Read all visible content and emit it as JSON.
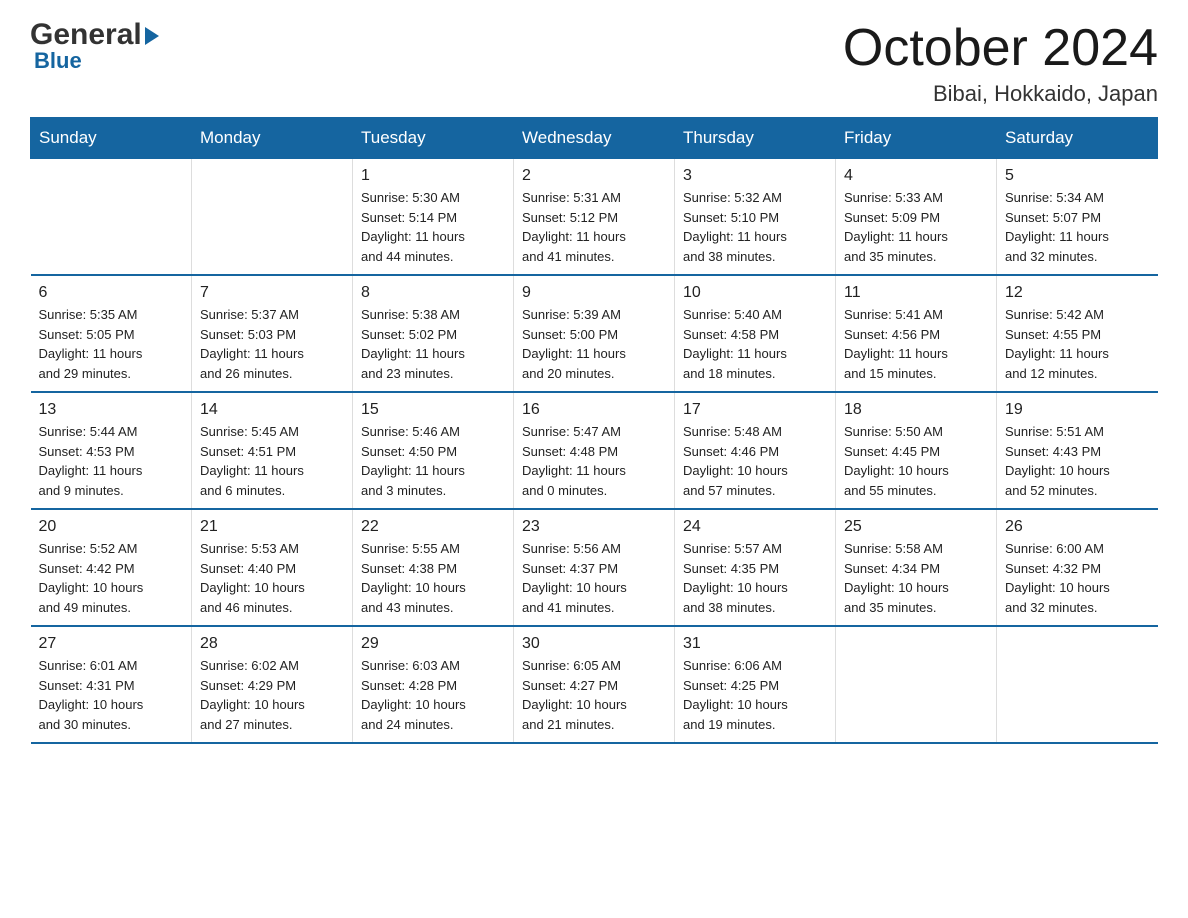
{
  "header": {
    "logo_general": "General",
    "logo_blue": "Blue",
    "title": "October 2024",
    "location": "Bibai, Hokkaido, Japan"
  },
  "calendar": {
    "days": [
      "Sunday",
      "Monday",
      "Tuesday",
      "Wednesday",
      "Thursday",
      "Friday",
      "Saturday"
    ],
    "weeks": [
      [
        {
          "number": "",
          "detail": ""
        },
        {
          "number": "",
          "detail": ""
        },
        {
          "number": "1",
          "detail": "Sunrise: 5:30 AM\nSunset: 5:14 PM\nDaylight: 11 hours\nand 44 minutes."
        },
        {
          "number": "2",
          "detail": "Sunrise: 5:31 AM\nSunset: 5:12 PM\nDaylight: 11 hours\nand 41 minutes."
        },
        {
          "number": "3",
          "detail": "Sunrise: 5:32 AM\nSunset: 5:10 PM\nDaylight: 11 hours\nand 38 minutes."
        },
        {
          "number": "4",
          "detail": "Sunrise: 5:33 AM\nSunset: 5:09 PM\nDaylight: 11 hours\nand 35 minutes."
        },
        {
          "number": "5",
          "detail": "Sunrise: 5:34 AM\nSunset: 5:07 PM\nDaylight: 11 hours\nand 32 minutes."
        }
      ],
      [
        {
          "number": "6",
          "detail": "Sunrise: 5:35 AM\nSunset: 5:05 PM\nDaylight: 11 hours\nand 29 minutes."
        },
        {
          "number": "7",
          "detail": "Sunrise: 5:37 AM\nSunset: 5:03 PM\nDaylight: 11 hours\nand 26 minutes."
        },
        {
          "number": "8",
          "detail": "Sunrise: 5:38 AM\nSunset: 5:02 PM\nDaylight: 11 hours\nand 23 minutes."
        },
        {
          "number": "9",
          "detail": "Sunrise: 5:39 AM\nSunset: 5:00 PM\nDaylight: 11 hours\nand 20 minutes."
        },
        {
          "number": "10",
          "detail": "Sunrise: 5:40 AM\nSunset: 4:58 PM\nDaylight: 11 hours\nand 18 minutes."
        },
        {
          "number": "11",
          "detail": "Sunrise: 5:41 AM\nSunset: 4:56 PM\nDaylight: 11 hours\nand 15 minutes."
        },
        {
          "number": "12",
          "detail": "Sunrise: 5:42 AM\nSunset: 4:55 PM\nDaylight: 11 hours\nand 12 minutes."
        }
      ],
      [
        {
          "number": "13",
          "detail": "Sunrise: 5:44 AM\nSunset: 4:53 PM\nDaylight: 11 hours\nand 9 minutes."
        },
        {
          "number": "14",
          "detail": "Sunrise: 5:45 AM\nSunset: 4:51 PM\nDaylight: 11 hours\nand 6 minutes."
        },
        {
          "number": "15",
          "detail": "Sunrise: 5:46 AM\nSunset: 4:50 PM\nDaylight: 11 hours\nand 3 minutes."
        },
        {
          "number": "16",
          "detail": "Sunrise: 5:47 AM\nSunset: 4:48 PM\nDaylight: 11 hours\nand 0 minutes."
        },
        {
          "number": "17",
          "detail": "Sunrise: 5:48 AM\nSunset: 4:46 PM\nDaylight: 10 hours\nand 57 minutes."
        },
        {
          "number": "18",
          "detail": "Sunrise: 5:50 AM\nSunset: 4:45 PM\nDaylight: 10 hours\nand 55 minutes."
        },
        {
          "number": "19",
          "detail": "Sunrise: 5:51 AM\nSunset: 4:43 PM\nDaylight: 10 hours\nand 52 minutes."
        }
      ],
      [
        {
          "number": "20",
          "detail": "Sunrise: 5:52 AM\nSunset: 4:42 PM\nDaylight: 10 hours\nand 49 minutes."
        },
        {
          "number": "21",
          "detail": "Sunrise: 5:53 AM\nSunset: 4:40 PM\nDaylight: 10 hours\nand 46 minutes."
        },
        {
          "number": "22",
          "detail": "Sunrise: 5:55 AM\nSunset: 4:38 PM\nDaylight: 10 hours\nand 43 minutes."
        },
        {
          "number": "23",
          "detail": "Sunrise: 5:56 AM\nSunset: 4:37 PM\nDaylight: 10 hours\nand 41 minutes."
        },
        {
          "number": "24",
          "detail": "Sunrise: 5:57 AM\nSunset: 4:35 PM\nDaylight: 10 hours\nand 38 minutes."
        },
        {
          "number": "25",
          "detail": "Sunrise: 5:58 AM\nSunset: 4:34 PM\nDaylight: 10 hours\nand 35 minutes."
        },
        {
          "number": "26",
          "detail": "Sunrise: 6:00 AM\nSunset: 4:32 PM\nDaylight: 10 hours\nand 32 minutes."
        }
      ],
      [
        {
          "number": "27",
          "detail": "Sunrise: 6:01 AM\nSunset: 4:31 PM\nDaylight: 10 hours\nand 30 minutes."
        },
        {
          "number": "28",
          "detail": "Sunrise: 6:02 AM\nSunset: 4:29 PM\nDaylight: 10 hours\nand 27 minutes."
        },
        {
          "number": "29",
          "detail": "Sunrise: 6:03 AM\nSunset: 4:28 PM\nDaylight: 10 hours\nand 24 minutes."
        },
        {
          "number": "30",
          "detail": "Sunrise: 6:05 AM\nSunset: 4:27 PM\nDaylight: 10 hours\nand 21 minutes."
        },
        {
          "number": "31",
          "detail": "Sunrise: 6:06 AM\nSunset: 4:25 PM\nDaylight: 10 hours\nand 19 minutes."
        },
        {
          "number": "",
          "detail": ""
        },
        {
          "number": "",
          "detail": ""
        }
      ]
    ]
  }
}
